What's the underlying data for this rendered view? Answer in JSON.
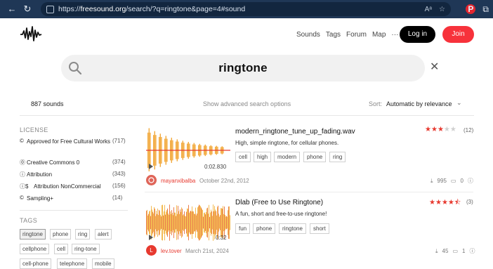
{
  "browser": {
    "url_prefix": "https://",
    "url_domain": "freesound.org",
    "url_rest": "/search/?q=ringtone&page=4#sound",
    "back_icon": "arrow-left-icon",
    "refresh_icon": "refresh-icon"
  },
  "header": {
    "nav": [
      "Sounds",
      "Tags",
      "Forum",
      "Map",
      "···"
    ],
    "login": "Log in",
    "join": "Join"
  },
  "search": {
    "query": "ringtone"
  },
  "results_bar": {
    "count": "887 sounds",
    "advanced": "Show advanced search options",
    "sort_label": "Sort:",
    "sort_value": "Automatic by relevance"
  },
  "sidebar": {
    "license_heading": "LICENSE",
    "licenses": [
      {
        "label": "Approved for Free Cultural Works",
        "count": "(717)",
        "icon": "©"
      },
      {
        "label": "Creative Commons 0",
        "count": "(374)",
        "icon": "⓪"
      },
      {
        "label": "Attribution",
        "count": "(343)",
        "icon": "ⓘ"
      },
      {
        "label": "Attribution NonCommercial",
        "count": "(156)",
        "icon": "ⓘ$"
      },
      {
        "label": "Sampling+",
        "count": "(14)",
        "icon": "©"
      }
    ],
    "tags_heading": "TAGS",
    "tags": [
      "ringtone",
      "phone",
      "ring",
      "alert",
      "cellphone",
      "cell",
      "ring-tone",
      "cell-phone",
      "telephone",
      "mobile"
    ]
  },
  "sounds": [
    {
      "title": "modern_ringtone_tune_up_fading.wav",
      "description": "High, simple ringtone, for cellular phones.",
      "tags": [
        "cell",
        "high",
        "modern",
        "phone",
        "ring"
      ],
      "duration": "0:02.830",
      "rating": 3,
      "rating_count": "(12)",
      "user": "mayanxibalba",
      "date": "October 22nd, 2012",
      "downloads": "995",
      "comments": "0",
      "avatar_color": "#d94a4a"
    },
    {
      "title": "Dlab (Free to Use Ringtone)",
      "description": "A fun, short and free-to-use ringtone!",
      "tags": [
        "fun",
        "phone",
        "ringtone",
        "short"
      ],
      "duration": "0:32",
      "rating": 4.5,
      "rating_count": "(3)",
      "user": "lev.tover",
      "date": "March 21st, 2024",
      "downloads": "45",
      "comments": "1",
      "avatar_initial": "L",
      "avatar_color": "#e7392f"
    }
  ]
}
